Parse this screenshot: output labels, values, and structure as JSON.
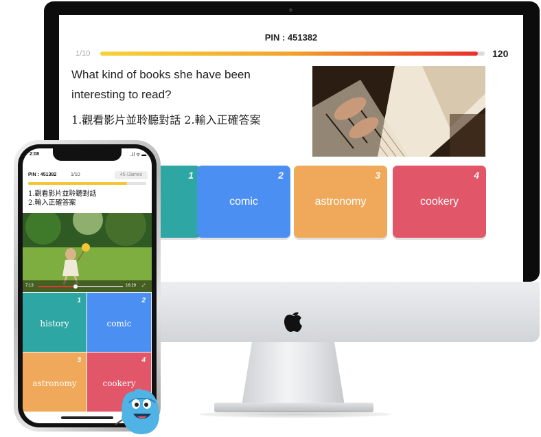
{
  "desktop": {
    "pin": "PIN : 451382",
    "progress_label": "1/10",
    "progress_fraction": 0.1,
    "timer": "120",
    "question": "What kind of books she have been interesting to read?",
    "instructions": "1.觀看影片並聆聽對話  2.輸入正確答案",
    "answers": [
      {
        "num": "1",
        "label": ""
      },
      {
        "num": "2",
        "label": "comic"
      },
      {
        "num": "3",
        "label": "astronomy"
      },
      {
        "num": "4",
        "label": "cookery"
      }
    ]
  },
  "phone": {
    "time": "2:08",
    "status": "..ll ᯤ ▬",
    "pin": "PIN : 451382",
    "progress_label": "1/10",
    "user": "45 /James",
    "instructions_line1": "1.觀看影片並聆聽對話",
    "instructions_line2": "2.輸入正確答案",
    "video_elapsed": "7:13",
    "video_total": "16:29",
    "answers": [
      {
        "num": "1",
        "label": "history"
      },
      {
        "num": "2",
        "label": "comic"
      },
      {
        "num": "3",
        "label": "astronomy"
      },
      {
        "num": "4",
        "label": "cookery"
      }
    ]
  },
  "colors": {
    "answer1": "#2ea6a3",
    "answer2": "#4c8ff2",
    "answer3": "#f0a95a",
    "answer4": "#e2566a"
  }
}
